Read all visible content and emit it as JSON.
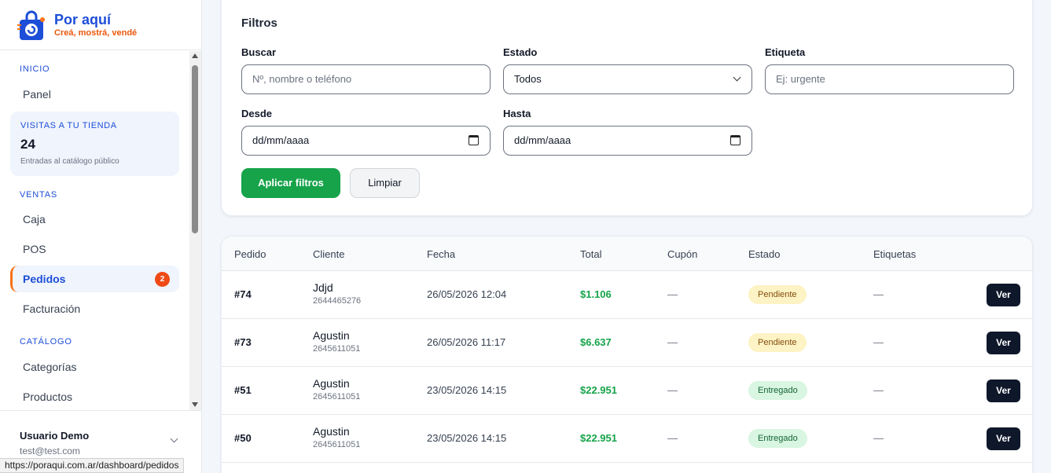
{
  "brand": {
    "name": "Por aquí",
    "tagline": "Creá, mostrá, vendé",
    "icon": "shopping-bag-logo-icon"
  },
  "sidebar": {
    "sections": {
      "inicio": "INICIO",
      "ventas": "VENTAS",
      "catalogo": "CATÁLOGO"
    },
    "items": {
      "panel": "Panel",
      "caja": "Caja",
      "pos": "POS",
      "pedidos": "Pedidos",
      "facturacion": "Facturación",
      "categorias": "Categorías",
      "productos": "Productos"
    },
    "pedidos_badge": "2",
    "visits": {
      "title": "VISITAS A TU TIENDA",
      "count": "24",
      "subtitle": "Entradas al catálogo público"
    },
    "user": {
      "name": "Usuario Demo",
      "email": "test@test.com"
    }
  },
  "status_bar_url": "https://poraqui.com.ar/dashboard/pedidos",
  "filters": {
    "title": "Filtros",
    "search": {
      "label": "Buscar",
      "placeholder": "Nº, nombre o teléfono"
    },
    "status": {
      "label": "Estado",
      "value": "Todos"
    },
    "tag": {
      "label": "Etiqueta",
      "placeholder": "Ej: urgente"
    },
    "from": {
      "label": "Desde",
      "value": "dd/mm/aaaa"
    },
    "to": {
      "label": "Hasta",
      "value": "dd/mm/aaaa"
    },
    "apply_label": "Aplicar filtros",
    "clear_label": "Limpiar"
  },
  "orders": {
    "headers": {
      "order": "Pedido",
      "client": "Cliente",
      "date": "Fecha",
      "total": "Total",
      "coupon": "Cupón",
      "status": "Estado",
      "tags": "Etiquetas"
    },
    "view_label": "Ver",
    "rows": [
      {
        "id": "#74",
        "name": "Jdjd",
        "phone": "2644465276",
        "date": "26/05/2026 12:04",
        "total": "$1.106",
        "coupon": "—",
        "status": "Pendiente",
        "tags": "—"
      },
      {
        "id": "#73",
        "name": "Agustin",
        "phone": "2645611051",
        "date": "26/05/2026 11:17",
        "total": "$6.637",
        "coupon": "—",
        "status": "Pendiente",
        "tags": "—"
      },
      {
        "id": "#51",
        "name": "Agustin",
        "phone": "2645611051",
        "date": "23/05/2026 14:15",
        "total": "$22.951",
        "coupon": "—",
        "status": "Entregado",
        "tags": "—"
      },
      {
        "id": "#50",
        "name": "Agustin",
        "phone": "2645611051",
        "date": "23/05/2026 14:15",
        "total": "$22.951",
        "coupon": "—",
        "status": "Entregado",
        "tags": "—"
      }
    ]
  },
  "colors": {
    "accent": "#1d4ed8",
    "primary_action": "#16a34a",
    "badge": "#ef4a17",
    "dark_button": "#0f172a"
  }
}
